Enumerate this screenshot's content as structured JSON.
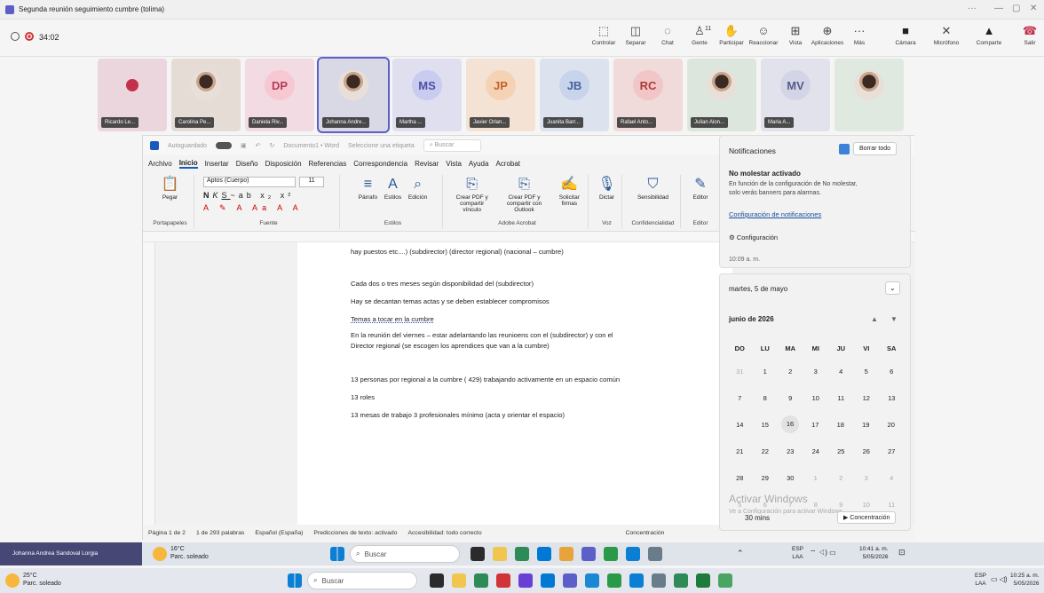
{
  "window": {
    "title": "Segunda reunión seguimiento cumbre (tolima)",
    "dots": "···",
    "minimize": "—",
    "restore": "▢",
    "close": "✕"
  },
  "meeting": {
    "timer": "34:02",
    "toolbar": [
      {
        "label": "Controlar",
        "icon": "control-icon",
        "glyph": "⬚"
      },
      {
        "label": "Separar",
        "icon": "pop-out-icon",
        "glyph": "◫"
      },
      {
        "label": "Chat",
        "icon": "chat-icon",
        "glyph": "◌"
      },
      {
        "label": "Gente",
        "icon": "people-icon",
        "glyph": "♙",
        "badge": "11"
      },
      {
        "label": "Participar",
        "icon": "raise-hand-icon",
        "glyph": "✋"
      },
      {
        "label": "Reaccionar",
        "icon": "react-icon",
        "glyph": "☺"
      },
      {
        "label": "Vista",
        "icon": "view-icon",
        "glyph": "⊞"
      },
      {
        "label": "Aplicaciones",
        "icon": "apps-icon",
        "glyph": "⊕"
      },
      {
        "label": "Más",
        "icon": "more-icon",
        "glyph": "···"
      },
      {
        "label": "Cámara",
        "icon": "camera-off-icon",
        "glyph": "■"
      },
      {
        "label": "Micrófono",
        "icon": "mic-off-icon",
        "glyph": "✕"
      },
      {
        "label": "Comparte",
        "icon": "share-icon",
        "glyph": "▲"
      },
      {
        "label": "Salir",
        "icon": "leave-icon",
        "glyph": "☎"
      }
    ],
    "participants": [
      {
        "name": "Ricardo Le...",
        "initials": "",
        "kind": "icon",
        "bg": "#ecd6de"
      },
      {
        "name": "Carolina Pe...",
        "initials": "",
        "kind": "photo",
        "bg": "#e5dcd6"
      },
      {
        "name": "Daniela Riv...",
        "initials": "DP",
        "kind": "initials",
        "bg": "#f2dbe2",
        "fg": "#b23c57",
        "avbg": "#f7c8d2"
      },
      {
        "name": "Johanna Andre...",
        "initials": "",
        "kind": "photo",
        "bg": "#d9d9e6"
      },
      {
        "name": "Martha ...",
        "initials": "MS",
        "kind": "initials",
        "bg": "#dfdff0",
        "fg": "#4b4fa6",
        "avbg": "#c9cbef"
      },
      {
        "name": "Javier Orlan...",
        "initials": "JP",
        "kind": "initials",
        "bg": "#f4e3d4",
        "fg": "#c0632a",
        "avbg": "#f6d2b5"
      },
      {
        "name": "Juanita Barr...",
        "initials": "JB",
        "kind": "initials",
        "bg": "#dde3ee",
        "fg": "#44609c",
        "avbg": "#c8d4ec"
      },
      {
        "name": "Rafael Anto...",
        "initials": "RC",
        "kind": "initials",
        "bg": "#f1dada",
        "fg": "#a83b3b",
        "avbg": "#f2c6c6"
      },
      {
        "name": "Julian Alon...",
        "initials": "",
        "kind": "photo",
        "bg": "#dde6dd"
      },
      {
        "name": "Maria A...",
        "initials": "MV",
        "kind": "initials",
        "bg": "#e2e2ec",
        "fg": "#555a8a",
        "avbg": "#d3d5e7"
      },
      {
        "name": "",
        "initials": "",
        "kind": "photo",
        "bg": "#dfe9df"
      }
    ]
  },
  "word": {
    "autosave": "Autoguardado",
    "docname": "Documento1 • Word",
    "label": "Seleccione una etiqueta",
    "search": "Buscar",
    "menu": [
      "Archivo",
      "Inicio",
      "Insertar",
      "Diseño",
      "Disposición",
      "Referencias",
      "Correspondencia",
      "Revisar",
      "Vista",
      "Ayuda",
      "Acrobat"
    ],
    "font": "Aptos (Cuerpo)",
    "size": "11",
    "ribbon": {
      "paste": "Pegar",
      "paragraph": "Párrafo",
      "styles": "Estilos",
      "editing": "Edición",
      "pdf1": "Crear PDF y compartir vínculo",
      "pdf2": "Crear PDF y compartir con Outlook",
      "sign": "Solicitar firmas",
      "dictate": "Dictar",
      "sensitivity": "Sensibilidad",
      "editor": "Editor",
      "g_clip": "Portapapeles",
      "g_font": "Fuente",
      "g_styles": "Estilos",
      "g_acrobat": "Adobe Acrobat",
      "g_voice": "Voz",
      "g_conf": "Confidencialidad",
      "g_editor": "Editor"
    },
    "lines": [
      "hay puestos etc....) (subdirector) (director regional) (nacional – cumbre)",
      "Cada dos o tres meses según disponibilidad del (subdirector)",
      "Hay se decantan temas actas y se deben establecer compromisos",
      "Temas a tocar en la cumbre",
      "En la reunión del viernes – estar adelantando las reunioens con el (subdirector) y con el",
      "Director regional (se escogen los aprendices que van a la cumbre)",
      "13 personas por regional a la cumbre ( 429) trabajando activamente en un espacio común",
      "13 roles",
      "13 mesas de trabajo 3 profesionales mínimo (acta y orientar el espacio)"
    ],
    "status": [
      "Página 1 de 2",
      "1 de 293 palabras",
      "Español (España)",
      "Predicciones de texto: activado",
      "Accesibilidad: todo correcto",
      "Concentración"
    ]
  },
  "notifications": {
    "title": "Notificaciones",
    "clear": "Borrar todo",
    "dnd": "No molestar activado",
    "dnd_text1": "En función de la configuración de No molestar,",
    "dnd_text2": "solo verás banners para alarmas.",
    "config_link": "Configuración de notificaciones",
    "settings": "Configuración",
    "time": "10:09 a. m."
  },
  "calendar": {
    "date": "martes, 5 de mayo",
    "month": "junio de 2026",
    "weekdays": [
      "DO",
      "LU",
      "MA",
      "MI",
      "JU",
      "VI",
      "SA"
    ],
    "weeks": [
      [
        "31",
        "1",
        "2",
        "3",
        "4",
        "5",
        "6"
      ],
      [
        "7",
        "8",
        "9",
        "10",
        "11",
        "12",
        "13"
      ],
      [
        "14",
        "15",
        "16",
        "17",
        "18",
        "19",
        "20"
      ],
      [
        "21",
        "22",
        "23",
        "24",
        "25",
        "26",
        "27"
      ],
      [
        "28",
        "29",
        "30",
        "1",
        "2",
        "3",
        "4"
      ],
      [
        "5",
        "6",
        "7",
        "8",
        "9",
        "10",
        "11"
      ]
    ],
    "focus_time": "30 mins",
    "focus_btn": "Concentración",
    "watermark1": "Activar Windows",
    "watermark2": "Ve a Configuración para activar Windows."
  },
  "taskbar1": {
    "user": "Johanna Andrea Sandoval Lorgia",
    "temp": "16°C",
    "weather": "Parc. soleado",
    "search": "Buscar",
    "lang1": "ESP",
    "lang2": "LAA",
    "time": "10:41 a. m.",
    "date": "5/05/2026"
  },
  "taskbar2": {
    "temp": "25°C",
    "weather": "Parc. soleado",
    "search": "Buscar",
    "lang1": "ESP",
    "lang2": "LAA",
    "time": "10:25 a. m.",
    "date": "5/05/2026"
  },
  "colors": {
    "accent": "#5b5fc7",
    "word_blue": "#185abd",
    "leave": "#c4314b",
    "record": "#d13438"
  }
}
